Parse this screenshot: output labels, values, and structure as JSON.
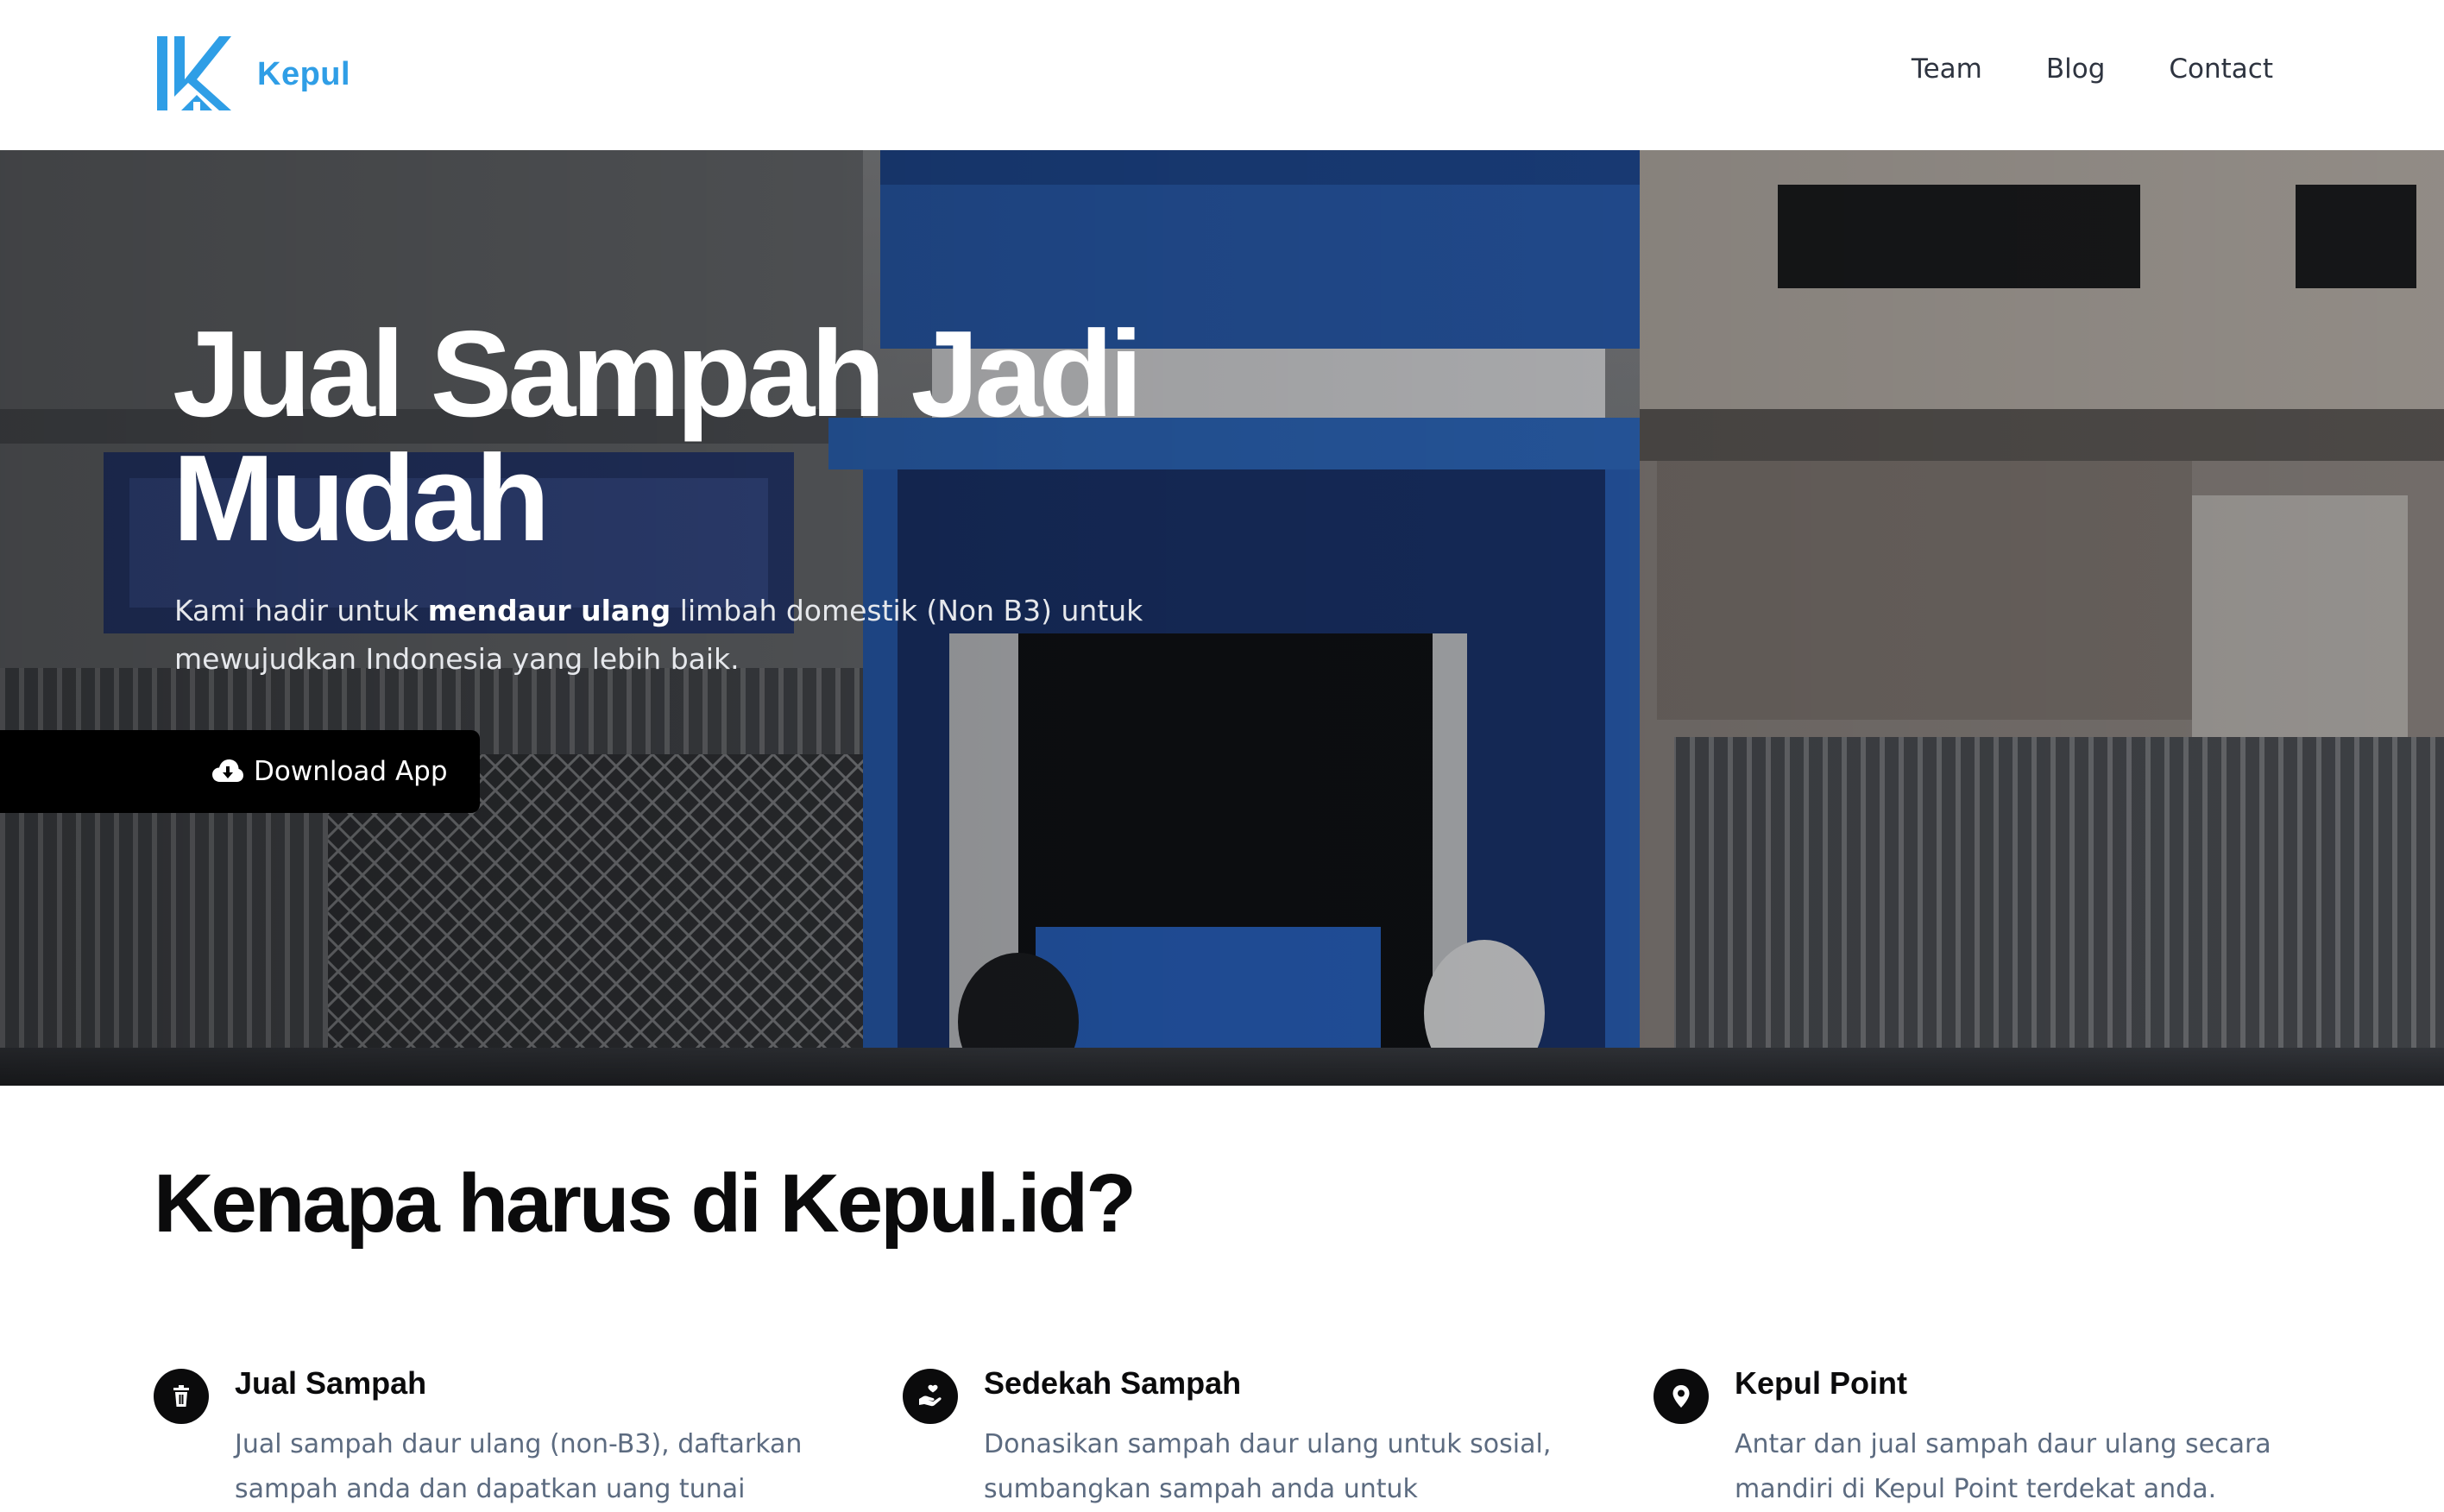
{
  "header": {
    "brand_name": "Kepul",
    "nav": [
      {
        "label": "Team"
      },
      {
        "label": "Blog"
      },
      {
        "label": "Contact"
      }
    ]
  },
  "hero": {
    "title": "Jual Sampah Jadi Mudah",
    "description_before": "Kami hadir untuk ",
    "description_bold": "mendaur ulang",
    "description_after": " limbah domestik (Non B3) untuk mewujudkan Indonesia yang lebih baik.",
    "download_label": "Download App",
    "download_icon": "cloud-download-icon"
  },
  "why": {
    "title": "Kenapa harus di Kepul.id?",
    "features": [
      {
        "icon": "trash-icon",
        "title": "Jual Sampah",
        "text": "Jual sampah daur ulang (non-B3), daftarkan sampah anda dan dapatkan uang tunai"
      },
      {
        "icon": "hand-heart-icon",
        "title": "Sedekah Sampah",
        "text": "Donasikan sampah daur ulang untuk sosial, sumbangkan sampah anda untuk"
      },
      {
        "icon": "map-pin-icon",
        "title": "Kepul Point",
        "text": "Antar dan jual sampah daur ulang secara mandiri di Kepul Point terdekat anda."
      }
    ]
  },
  "colors": {
    "brand": "#2f9ee6",
    "text_dark": "#0b0b0c",
    "text_muted": "#5c6b80",
    "button": "#000000"
  }
}
